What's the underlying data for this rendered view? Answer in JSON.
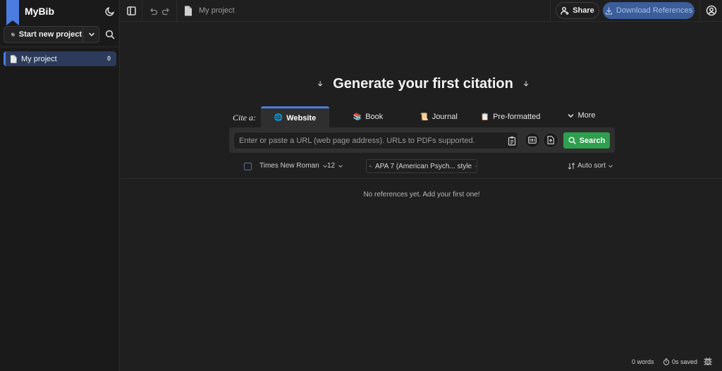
{
  "app": {
    "name": "MyBib",
    "accent_color": "#4c7ce0",
    "search_button_color": "#2e9e4f"
  },
  "sidebar": {
    "start_new_project_label": "Start new project",
    "projects": [
      {
        "label": "My project",
        "count": "0",
        "icon": "document-icon"
      }
    ]
  },
  "topbar": {
    "project_title": "My project",
    "share_label": "Share",
    "download_label": "Download References"
  },
  "main": {
    "headline": "Generate your first citation",
    "cite_label": "Cite a:",
    "tabs": [
      {
        "label": "Website",
        "icon": "🌐",
        "active": true
      },
      {
        "label": "Book",
        "icon": "📚",
        "active": false
      },
      {
        "label": "Journal",
        "icon": "📜",
        "active": false
      },
      {
        "label": "Pre-formatted",
        "icon": "📋",
        "active": false
      },
      {
        "label": "More",
        "icon": "chevron-down-icon",
        "active": false
      }
    ],
    "url_placeholder": "Enter or paste a URL (web page address). URLs to PDFs supported.",
    "search_label": "Search",
    "font_family": "Times New Roman",
    "font_size": "12",
    "citation_style": "APA 7 (American Psych... style",
    "sort_label": "Auto sort",
    "empty_message": "No references yet. Add your first one!"
  },
  "footer": {
    "word_count": "0 words",
    "saved_status": "0s saved"
  }
}
